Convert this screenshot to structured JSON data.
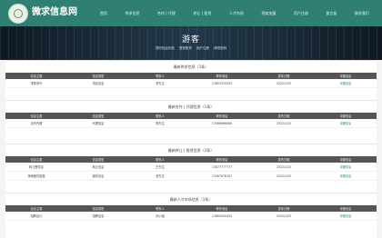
{
  "header": {
    "site_title": "微求信息网",
    "nav": [
      "首页",
      "供求信息",
      "合作 | 代理",
      "转让 | 租赁",
      "人才市场",
      "招商加盟",
      "用户注册",
      "留言板",
      "联系我们"
    ]
  },
  "banner": {
    "title": "游客",
    "crumbs": [
      "您好欢迎光临",
      "登录账号",
      "用户注册",
      "修改密码"
    ]
  },
  "columns": [
    "信息主题",
    "信息类型",
    "联系人",
    "联系电话",
    "发布日期",
    "详细信息"
  ],
  "sections": [
    {
      "title": "最新供求信息（1条）",
      "rows": [
        [
          "求购茶叶",
          "供应信息",
          "李先生",
          "13803333333",
          "2022/1/25",
          "详细信息"
        ]
      ]
    },
    {
      "title": "最新合作 | 代理信息（1条）",
      "rows": [
        [
          "合作代理",
          "代理信息",
          "陈先生",
          "13566666666",
          "2022/1/25",
          "详细信息"
        ]
      ]
    },
    {
      "title": "最新转让 | 租赁信息（2条）",
      "rows": [
        [
          "转让餐饮店",
          "转让信息",
          "王先生",
          "13877777777",
          "2022/1/25",
          "详细信息"
        ],
        [
          "场地租赁招租",
          "租赁信息",
          "张先生",
          "13367878787",
          "2022/1/25",
          "详细信息"
        ]
      ]
    },
    {
      "title": "最新人才市场信息（1条）",
      "rows": [
        [
          "招聘会计",
          "招聘信息",
          "孙小姐",
          "13864545454",
          "2022/1/25",
          "详细信息"
        ]
      ]
    }
  ]
}
